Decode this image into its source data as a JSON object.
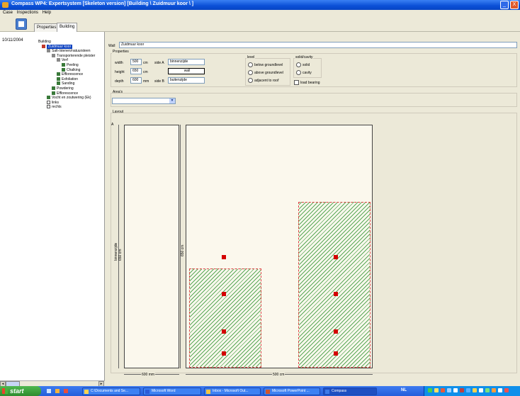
{
  "window": {
    "title": "Compass WP4: Expertsystem [Skeleton version] [Building \\ Zuidmuur koor \\ ]",
    "minimize_glyph": "_",
    "close_glyph": "X"
  },
  "menu": [
    "Case",
    "Inspections",
    "Help"
  ],
  "tabs": [
    {
      "label": "Properties",
      "active": false
    },
    {
      "label": "Building",
      "active": true
    }
  ],
  "sidebar": {
    "date": "10/11/2004",
    "tree": [
      {
        "label": "Building",
        "level": 0,
        "icon": "none"
      },
      {
        "label": "Zuidmuur koor",
        "level": 1,
        "icon": "wall-icon",
        "selected": true
      },
      {
        "label": "Salt-/stenen/natuursteen",
        "level": 2,
        "icon": "expand-icon"
      },
      {
        "label": "Transporterende pleister",
        "level": 3,
        "icon": "expand-icon"
      },
      {
        "label": "Verf",
        "level": 4,
        "icon": "expand-icon"
      },
      {
        "label": "Peeling",
        "level": 5,
        "icon": "damage-icon"
      },
      {
        "label": "Chalking",
        "level": 5,
        "icon": "damage-icon"
      },
      {
        "label": "Efflorescence",
        "level": 4,
        "icon": "damage-icon"
      },
      {
        "label": "Exfoliation",
        "level": 4,
        "icon": "damage-icon"
      },
      {
        "label": "Sanding",
        "level": 4,
        "icon": "damage-icon"
      },
      {
        "label": "Powdering",
        "level": 3,
        "icon": "damage-icon"
      },
      {
        "label": "Efflorescence",
        "level": 3,
        "icon": "damage-icon"
      },
      {
        "label": "Vocht en zoutwering (Ek)",
        "level": 2,
        "icon": "damage-icon"
      },
      {
        "label": "links",
        "level": 2,
        "icon": "checkbox-icon"
      },
      {
        "label": "rechts",
        "level": 2,
        "icon": "checkbox-icon"
      }
    ]
  },
  "form": {
    "wall_label": "Wall",
    "wall_value": "Zuidmuur koor",
    "properties_title": "Properties",
    "width_label": "width",
    "width_value": "500",
    "width_unit": "cm",
    "height_label": "height",
    "height_value": "650",
    "height_unit": "cm",
    "depth_label": "depth",
    "depth_value": "600",
    "depth_unit": "mm",
    "sideA_label": "side A",
    "sideA_value": "binnenzijde",
    "middle_value": "wall",
    "sideB_label": "side B",
    "sideB_value": "buitenzijde",
    "level_title": "level",
    "level_options": [
      "below groundlevel",
      "above groundlevel",
      "adjacent to roof"
    ],
    "solid_title": "solid/cavity",
    "solid_options": [
      "solid",
      "cavity"
    ],
    "load_bearing_label": "load bearing",
    "areas_title": "Area's",
    "areas_value": "",
    "layout_title": "Layout"
  },
  "layout": {
    "side_marker": "A",
    "left_height_label": "binnenzijde",
    "left_height_value": "650 cm",
    "right_height_value": "650 cm",
    "left_width_value": "600 mm",
    "right_width_value": "500 cm"
  },
  "taskbar": {
    "start_label": "start",
    "tasks": [
      {
        "label": "C:\\Documents and Se...",
        "active": false
      },
      {
        "label": "Microsoft Word",
        "active": false
      },
      {
        "label": "Inbox - Microsoft Out...",
        "active": false
      },
      {
        "label": "Microsoft PowerPoint ...",
        "active": false
      },
      {
        "label": "Compass",
        "active": true
      }
    ],
    "language": "NL"
  }
}
